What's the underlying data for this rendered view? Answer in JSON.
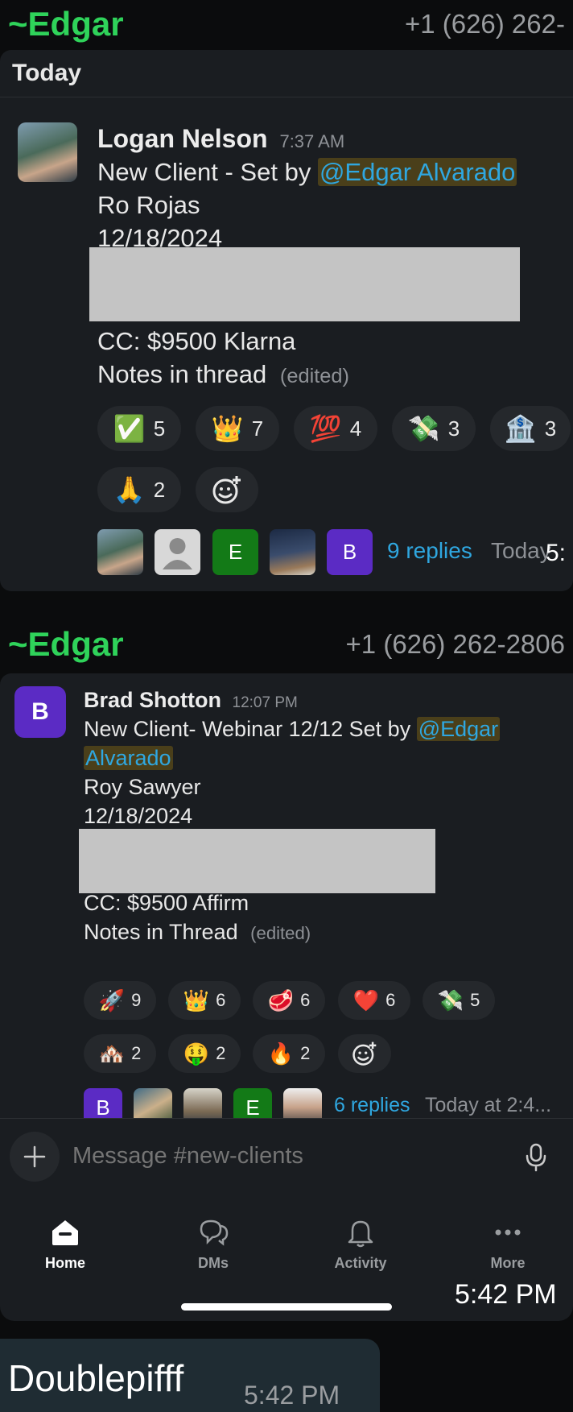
{
  "top_sender": {
    "name": "~Edgar",
    "phone": "+1 (626) 262-"
  },
  "day_divider": "Today",
  "message1": {
    "author": "Logan Nelson",
    "time": "7:37 AM",
    "line1_prefix": "New Client - Set by ",
    "mention": "@Edgar Alvarado",
    "line2": "Ro Rojas",
    "line3": "12/18/2024",
    "line4": "CC: $9500 Klarna",
    "line5": "Notes in thread",
    "edited": "(edited)",
    "reactions": [
      {
        "emoji": "✅",
        "count": "5"
      },
      {
        "emoji": "👑",
        "count": "7"
      },
      {
        "emoji": "💯",
        "count": "4"
      },
      {
        "emoji": "💸",
        "count": "3"
      },
      {
        "emoji": "🏦",
        "count": "3"
      },
      {
        "emoji": "🙏",
        "count": "2"
      }
    ],
    "reply_avatars": [
      "",
      "",
      "E",
      "",
      "B"
    ],
    "replies": "9 replies",
    "reply_time": "Today",
    "overlay_time": "5:"
  },
  "second_sender": {
    "name": "~Edgar",
    "phone": "+1 (626) 262-2806"
  },
  "message2": {
    "avatar_letter": "B",
    "author": "Brad Shotton",
    "time": "12:07 PM",
    "line1_prefix": "New Client- Webinar 12/12 Set by ",
    "mention_part1": "@Edgar",
    "mention_part2": "Alvarado",
    "line2": "Roy Sawyer",
    "line3": "12/18/2024",
    "line4": "CC: $9500 Affirm",
    "line5": "Notes in Thread",
    "edited": "(edited)",
    "reactions": [
      {
        "emoji": "🚀",
        "count": "9"
      },
      {
        "emoji": "👑",
        "count": "6"
      },
      {
        "emoji": "🥩",
        "count": "6"
      },
      {
        "emoji": "❤️",
        "count": "6"
      },
      {
        "emoji": "💸",
        "count": "5"
      },
      {
        "emoji": "🏘️",
        "count": "2"
      },
      {
        "emoji": "🤑",
        "count": "2"
      },
      {
        "emoji": "🔥",
        "count": "2"
      }
    ],
    "reply_avatars": [
      "B",
      "",
      "",
      "E",
      ""
    ],
    "replies": "6 replies",
    "reply_time": "Today at 2:4..."
  },
  "composer": {
    "placeholder": "Message #new-clients"
  },
  "tabs": [
    {
      "label": "Home"
    },
    {
      "label": "DMs"
    },
    {
      "label": "Activity"
    },
    {
      "label": "More"
    }
  ],
  "screenshot_time": "5:42 PM",
  "footer": {
    "sender": "Doublepifff",
    "time": "5:42 PM"
  },
  "colors": {
    "accent_green": "#2fd35a",
    "link_blue": "#2fa7e0",
    "avatar_purple": "#5b2bc4",
    "avatar_green": "#137a17"
  }
}
